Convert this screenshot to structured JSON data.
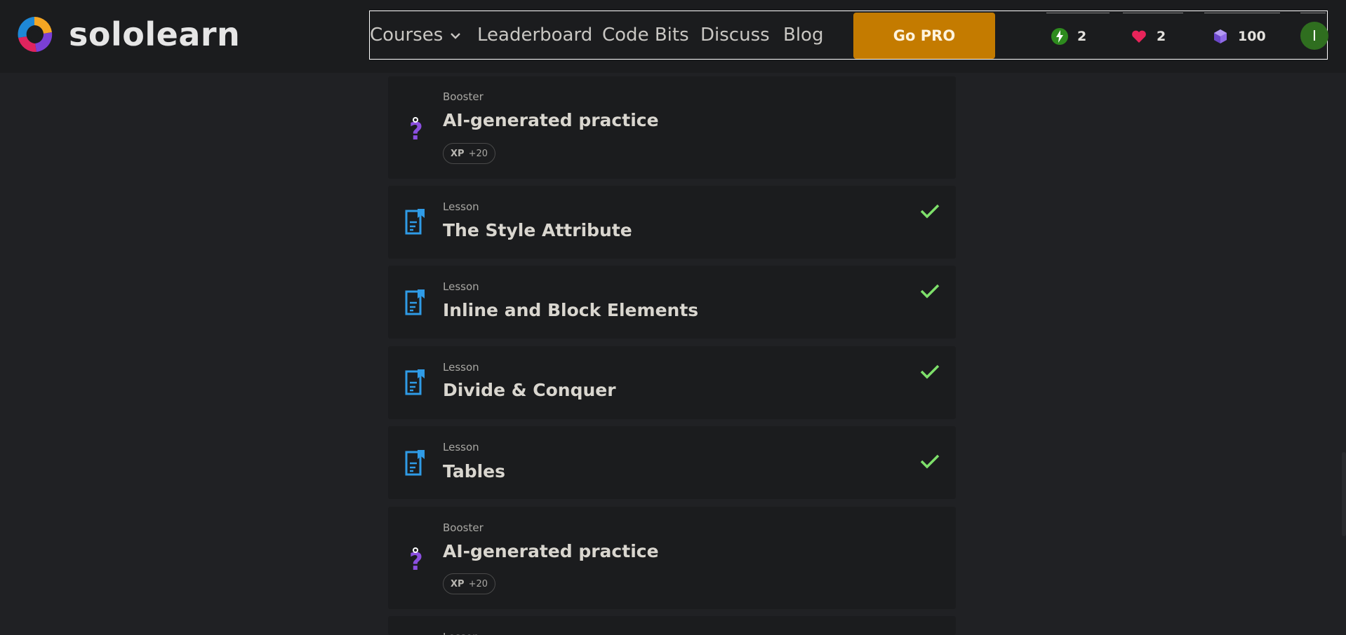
{
  "app": {
    "logo_text": "sololearn"
  },
  "nav": {
    "courses": "Courses",
    "leaderboard": "Leaderboard",
    "code_bits": "Code Bits",
    "discuss": "Discuss",
    "blog": "Blog",
    "go_pro": "Go PRO"
  },
  "stats": {
    "streak": "2",
    "hearts": "2",
    "gems": "100",
    "avatar_initial": "I"
  },
  "colors": {
    "go_pro_bg": "#c47b00",
    "check": "#7ee06a",
    "lesson_icon": "#2f9be6",
    "booster_icon": "#8b4fe0"
  },
  "items": [
    {
      "type": "Booster",
      "title": "AI-generated practice",
      "xp_label": "XP",
      "xp_value": "+20",
      "completed": false
    },
    {
      "type": "Lesson",
      "title": "The Style Attribute",
      "completed": true
    },
    {
      "type": "Lesson",
      "title": "Inline and Block Elements",
      "completed": true
    },
    {
      "type": "Lesson",
      "title": "Divide & Conquer",
      "completed": true
    },
    {
      "type": "Lesson",
      "title": "Tables",
      "completed": true
    },
    {
      "type": "Booster",
      "title": "AI-generated practice",
      "xp_label": "XP",
      "xp_value": "+20",
      "completed": false
    },
    {
      "type": "Lesson",
      "title": "",
      "completed": false
    }
  ]
}
